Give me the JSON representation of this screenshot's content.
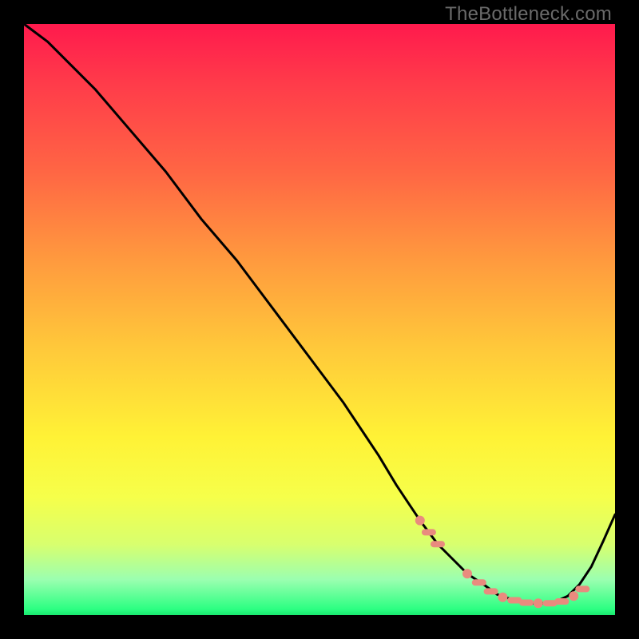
{
  "watermark": "TheBottleneck.com",
  "chart_data": {
    "type": "line",
    "title": "",
    "xlabel": "",
    "ylabel": "",
    "xlim": [
      0,
      100
    ],
    "ylim": [
      0,
      100
    ],
    "x": [
      0,
      4,
      8,
      12,
      18,
      24,
      30,
      36,
      42,
      48,
      54,
      58,
      60,
      63,
      67,
      70,
      72,
      75,
      78,
      80,
      83,
      86,
      88,
      90,
      92,
      94,
      96,
      98,
      100
    ],
    "values": [
      100,
      97,
      93,
      89,
      82,
      75,
      67,
      60,
      52,
      44,
      36,
      30,
      27,
      22,
      16,
      12,
      10,
      7,
      5,
      3.5,
      2.5,
      2,
      2,
      2.3,
      3.2,
      5.2,
      8.2,
      12.5,
      17
    ],
    "markers": {
      "x": [
        67,
        68.5,
        70,
        75,
        77,
        79,
        81,
        83,
        85,
        87,
        89,
        91,
        93,
        94.5
      ],
      "y": [
        16,
        14,
        12,
        7,
        5.5,
        4,
        3,
        2.5,
        2.1,
        2,
        2,
        2.3,
        3.2,
        4.4
      ],
      "color": "#e98b7e"
    },
    "stroke_color": "#000000"
  }
}
